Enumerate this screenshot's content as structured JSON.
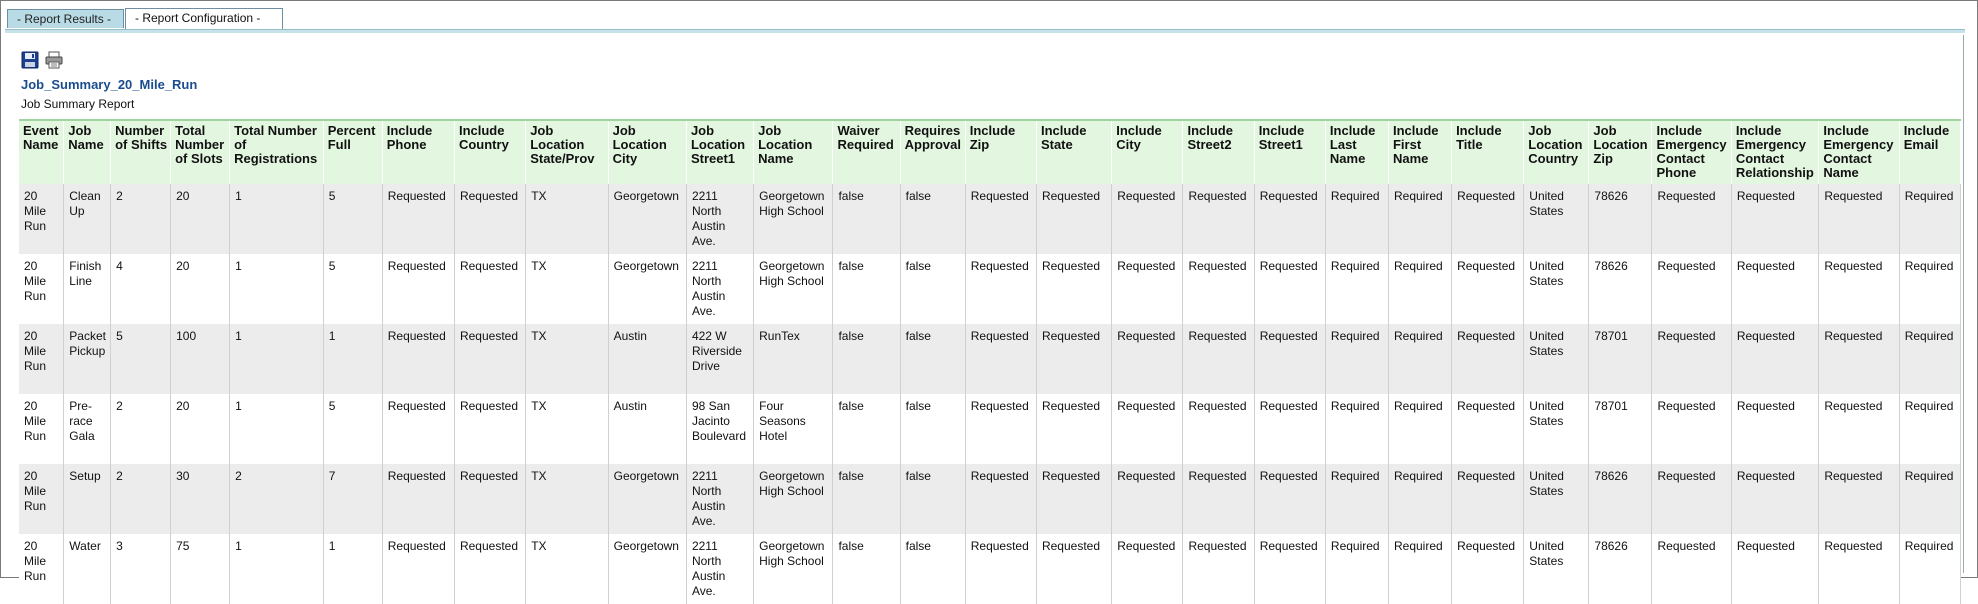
{
  "tabs": [
    {
      "label": "- Report Results -"
    },
    {
      "label": "- Report Configuration -"
    }
  ],
  "toolbar": {
    "save_icon": "save-icon",
    "print_icon": "print-icon"
  },
  "report": {
    "title": "Job_Summary_20_Mile_Run",
    "subtitle": "Job Summary Report"
  },
  "table": {
    "headers": [
      "Event Name",
      "Job Name",
      "Number of Shifts",
      "Total Number of Slots",
      "Total Number of Registrations",
      "Percent Full",
      "Include Phone",
      "Include Country",
      "Job Location State/Prov",
      "Job Location City",
      "Job Location Street1",
      "Job Location Name",
      "Waiver Required",
      "Requires Approval",
      "Include Zip",
      "Include State",
      "Include City",
      "Include Street2",
      "Include Street1",
      "Include Last Name",
      "Include First Name",
      "Include Title",
      "Job Location Country",
      "Job Location Zip",
      "Include Emergency Contact Phone",
      "Include Emergency Contact Relationship",
      "Include Emergency Contact Name",
      "Include Email"
    ],
    "rows": [
      [
        "20 Mile Run",
        "Clean Up",
        "2",
        "20",
        "1",
        "5",
        "Requested",
        "Requested",
        "TX",
        "Georgetown",
        "2211 North Austin Ave.",
        "Georgetown High School",
        "false",
        "false",
        "Requested",
        "Requested",
        "Requested",
        "Requested",
        "Requested",
        "Required",
        "Required",
        "Requested",
        "United States",
        "78626",
        "Requested",
        "Requested",
        "Requested",
        "Required"
      ],
      [
        "20 Mile Run",
        "Finish Line",
        "4",
        "20",
        "1",
        "5",
        "Requested",
        "Requested",
        "TX",
        "Georgetown",
        "2211 North Austin Ave.",
        "Georgetown High School",
        "false",
        "false",
        "Requested",
        "Requested",
        "Requested",
        "Requested",
        "Requested",
        "Required",
        "Required",
        "Requested",
        "United States",
        "78626",
        "Requested",
        "Requested",
        "Requested",
        "Required"
      ],
      [
        "20 Mile Run",
        "Packet Pickup",
        "5",
        "100",
        "1",
        "1",
        "Requested",
        "Requested",
        "TX",
        "Austin",
        "422 W Riverside Drive",
        "RunTex",
        "false",
        "false",
        "Requested",
        "Requested",
        "Requested",
        "Requested",
        "Requested",
        "Required",
        "Required",
        "Requested",
        "United States",
        "78701",
        "Requested",
        "Requested",
        "Requested",
        "Required"
      ],
      [
        "20 Mile Run",
        "Pre-race Gala",
        "2",
        "20",
        "1",
        "5",
        "Requested",
        "Requested",
        "TX",
        "Austin",
        "98 San Jacinto Boulevard",
        "Four Seasons Hotel",
        "false",
        "false",
        "Requested",
        "Requested",
        "Requested",
        "Requested",
        "Requested",
        "Required",
        "Required",
        "Requested",
        "United States",
        "78701",
        "Requested",
        "Requested",
        "Requested",
        "Required"
      ],
      [
        "20 Mile Run",
        "Setup",
        "2",
        "30",
        "2",
        "7",
        "Requested",
        "Requested",
        "TX",
        "Georgetown",
        "2211 North Austin Ave.",
        "Georgetown High School",
        "false",
        "false",
        "Requested",
        "Requested",
        "Requested",
        "Requested",
        "Requested",
        "Required",
        "Required",
        "Requested",
        "United States",
        "78626",
        "Requested",
        "Requested",
        "Requested",
        "Required"
      ],
      [
        "20 Mile Run",
        "Water",
        "3",
        "75",
        "1",
        "1",
        "Requested",
        "Requested",
        "TX",
        "Georgetown",
        "2211 North Austin Ave.",
        "Georgetown High School",
        "false",
        "false",
        "Requested",
        "Requested",
        "Requested",
        "Requested",
        "Requested",
        "Required",
        "Required",
        "Requested",
        "United States",
        "78626",
        "Requested",
        "Requested",
        "Requested",
        "Required"
      ]
    ]
  }
}
